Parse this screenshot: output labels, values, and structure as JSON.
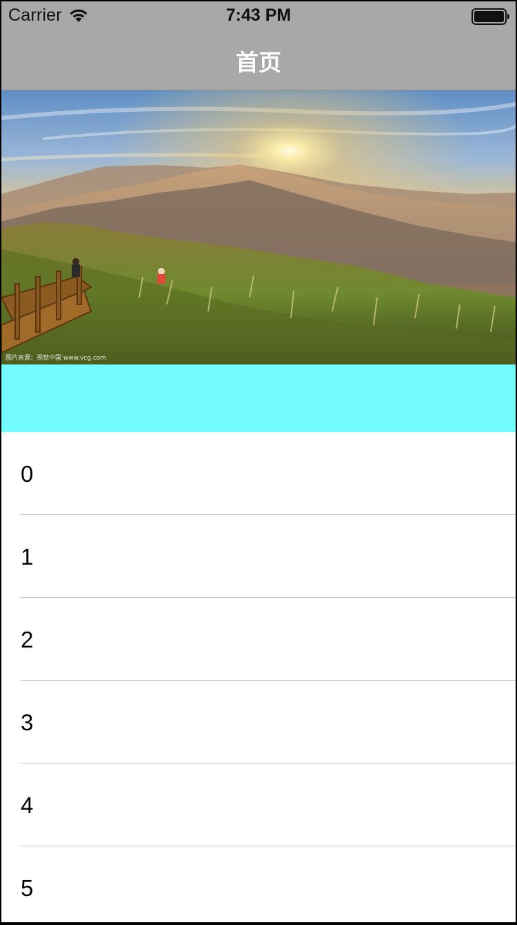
{
  "status_bar": {
    "carrier": "Carrier",
    "time": "7:43 PM",
    "wifi_icon": "wifi-icon",
    "battery_icon": "battery-icon"
  },
  "nav": {
    "title": "首页"
  },
  "banner": {
    "caption": "图片来源：视觉中国 www.vcg.com",
    "description_icon": "landscape-photo"
  },
  "colors": {
    "nav_background": "#a8a8a8",
    "section_header": "#73fcfd",
    "separator": "#c8c7cc"
  },
  "list": {
    "items": [
      {
        "label": "0"
      },
      {
        "label": "1"
      },
      {
        "label": "2"
      },
      {
        "label": "3"
      },
      {
        "label": "4"
      },
      {
        "label": "5"
      }
    ]
  }
}
